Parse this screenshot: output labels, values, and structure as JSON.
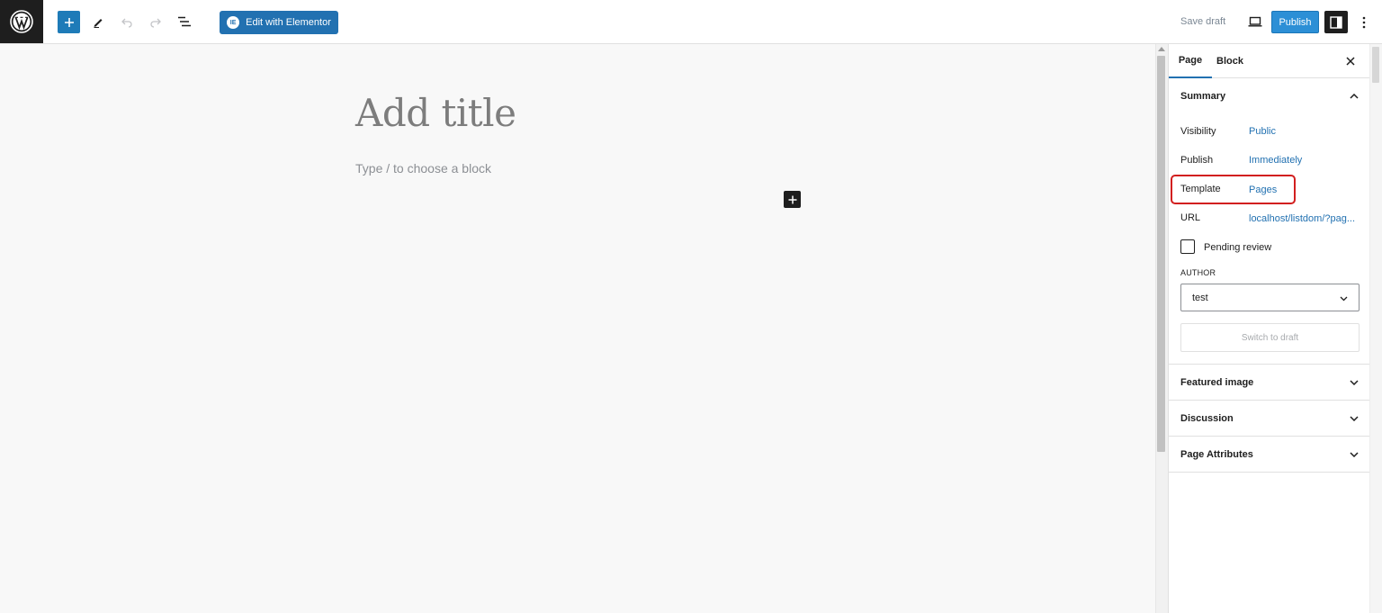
{
  "toolbar": {
    "logo_icon": "wordpress-logo",
    "elementor_badge": "IE",
    "elementor_label": "Edit with Elementor",
    "save_draft_label": "Save draft",
    "publish_label": "Publish",
    "accent": "#2271b1"
  },
  "editor": {
    "title_placeholder": "Add title",
    "block_placeholder": "Type / to choose a block"
  },
  "sidebar": {
    "tabs": [
      "Page",
      "Block"
    ],
    "active_tab": "Page",
    "summary": {
      "heading": "Summary",
      "rows": [
        {
          "label": "Visibility",
          "value": "Public"
        },
        {
          "label": "Publish",
          "value": "Immediately"
        },
        {
          "label": "Template",
          "value": "Pages"
        },
        {
          "label": "URL",
          "value": "localhost/listdom/?pag..."
        }
      ],
      "pending_review_label": "Pending review",
      "pending_review_checked": false,
      "author_label": "AUTHOR",
      "author_value": "test",
      "switch_to_draft_label": "Switch to draft"
    },
    "panels": [
      {
        "label": "Featured image",
        "expanded": false
      },
      {
        "label": "Discussion",
        "expanded": false
      },
      {
        "label": "Page Attributes",
        "expanded": false
      }
    ],
    "highlight_color": "#d21f1f"
  }
}
